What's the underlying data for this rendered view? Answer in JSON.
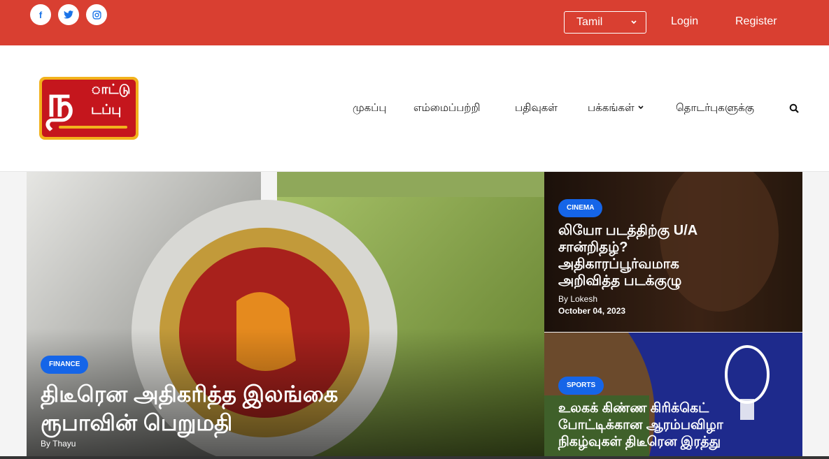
{
  "colors": {
    "topbar": "#d93f31",
    "badge": "#1565e8",
    "logo_red": "#c5161d",
    "logo_yellow": "#f2b21c"
  },
  "social": [
    {
      "icon": "facebook-icon",
      "glyph": "f"
    },
    {
      "icon": "twitter-icon",
      "glyph": "t"
    },
    {
      "icon": "instagram-icon",
      "glyph": "◎"
    }
  ],
  "topbar": {
    "language": "Tamil",
    "login": "Login",
    "register": "Register"
  },
  "logo": {
    "line1": "நாட்டு",
    "big": "ந",
    "top": "ாட்டு",
    "bottom": "டப்பு"
  },
  "nav": {
    "items": [
      "முகப்பு",
      "எம்மைப்பற்றி",
      "பதிவுகள்",
      "பக்கங்கள்",
      "தொடர்புகளுக்கு"
    ],
    "dropdown_index": 3
  },
  "feature": {
    "category": "FINANCE",
    "title_line1": "திடீரென அதிகரித்த இலங்கை",
    "title_line2": "ரூபாவின் பெறுமதி",
    "author": "By Thayu"
  },
  "cinema": {
    "category": "CINEMA",
    "title_line1": "லியோ படத்திற்கு U/A",
    "title_line2": "சான்றிதழ்?",
    "title_line3": "அதிகாரப்பூர்வமாக",
    "title_line4": "அறிவித்த படக்குழு",
    "author": "By Lokesh",
    "date": "October 04, 2023"
  },
  "sports": {
    "category": "SPORTS",
    "title_line1": "உலகக் கிண்ண கிரிக்கெட்",
    "title_line2": "போட்டிக்கான ஆரம்பவிழா",
    "title_line3": "நிகழ்வுகள் திடீரென இரத்து"
  }
}
